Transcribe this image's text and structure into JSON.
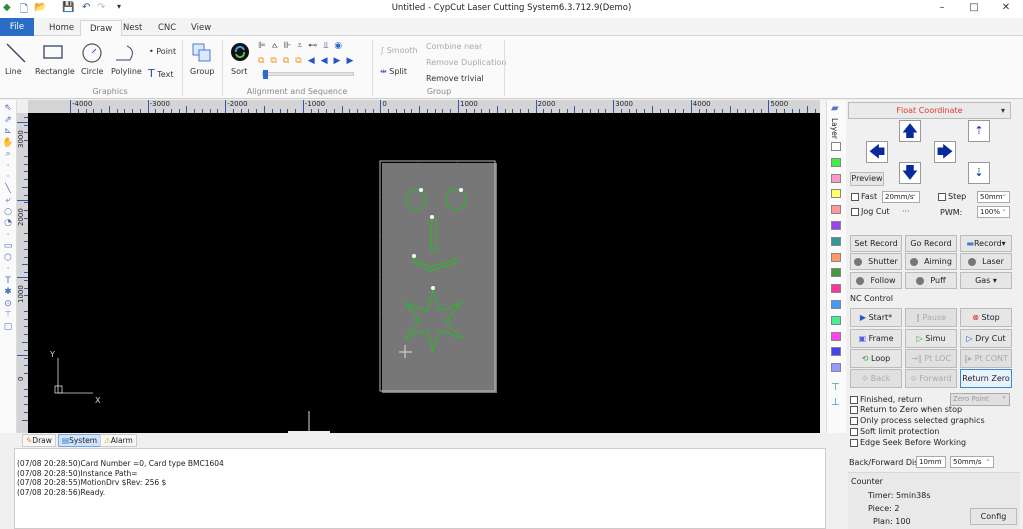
{
  "window": {
    "title": "Untitled - CypCut Laser Cutting System6.3.712.9(Demo)"
  },
  "tabs": [
    "File",
    "Home",
    "Draw",
    "Nest",
    "CNC",
    "View"
  ],
  "ribbon": {
    "graphics": {
      "label": "Graphics",
      "line": "Line",
      "rectangle": "Rectangle",
      "circle": "Circle",
      "polyline": "Polyline",
      "point": "Point",
      "text": "Text"
    },
    "group": "Group",
    "sort": "Sort",
    "alignment_label": "Alignment and Sequence",
    "smooth": "Smooth",
    "split": "Split",
    "combine_near": "Combine near",
    "remove_duplication": "Remove Duplication",
    "remove_trivial": "Remove trivial",
    "group_label": "Group"
  },
  "ruler": {
    "x": [
      "-4000",
      "-3000",
      "-2000",
      "-1000",
      "0",
      "1000",
      "2000",
      "3000",
      "4000",
      "5000"
    ],
    "y": [
      "3000",
      "2000",
      "1000",
      "0"
    ]
  },
  "axes": {
    "x": "X",
    "y": "Y"
  },
  "layers": {
    "label": "Layer",
    "colors": [
      "#ffffff",
      "#44ee44",
      "#ff99cc",
      "#ffff66",
      "#ff9999",
      "#9944ee",
      "#339999",
      "#ff9966",
      "#449944",
      "#ff3399",
      "#4499ff",
      "#44ee99",
      "#ff44ee",
      "#4444ee",
      "#9999ff"
    ]
  },
  "bottom_tabs": [
    "Draw",
    "System",
    "Alarm"
  ],
  "log": [
    "(07/08 20:28:50)Card Number =0, Card type BMC1604",
    "(07/08 20:28:50)Instance Path=",
    "(07/08 20:28:55)MotionDrv $Rev: 256 $",
    "(07/08 20:28:56)Ready."
  ],
  "panel": {
    "coordinate": "Float Coordinate",
    "coordinate_color": "#e53935",
    "preview": "Preview",
    "fast": "Fast",
    "fast_speed": "20mm/s",
    "step": "Step",
    "step_value": "50mm",
    "jog_cut": "Jog Cut",
    "jog_dots": "···",
    "pwm": "PWM:",
    "pwm_value": "100%",
    "set_record": "Set Record",
    "go_record": "Go Record",
    "record": "Record",
    "shutter": "Shutter",
    "aiming": "Aiming",
    "laser": "Laser",
    "follow": "Follow",
    "puff": "Puff",
    "gas": "Gas",
    "nc_control": "NC Control",
    "start": "Start*",
    "pause": "Pause",
    "stop": "Stop",
    "frame": "Frame",
    "simu": "Simu",
    "dry_cut": "Dry Cut",
    "loop": "Loop",
    "pt_loc": "Pt LOC",
    "pt_cont": "Pt CONT",
    "back": "Back",
    "forward": "Forward",
    "return_zero": "Return Zero",
    "finished_return": "Finished, return",
    "zero_point": "Zero Point",
    "return_zero_stop": "Return to Zero when stop",
    "only_selected": "Only process selected graphics",
    "soft_limit": "Soft limit protection",
    "edge_seek": "Edge Seek Before Working",
    "bf_dis": "Back/Forward Dis:",
    "bf_dis_value": "10mm",
    "bf_speed": "50mm/s",
    "counter": "Counter",
    "timer": "Timer: 5min38s",
    "piece": "Piece: 2",
    "plan": "Plan: 100",
    "config": "Config"
  }
}
